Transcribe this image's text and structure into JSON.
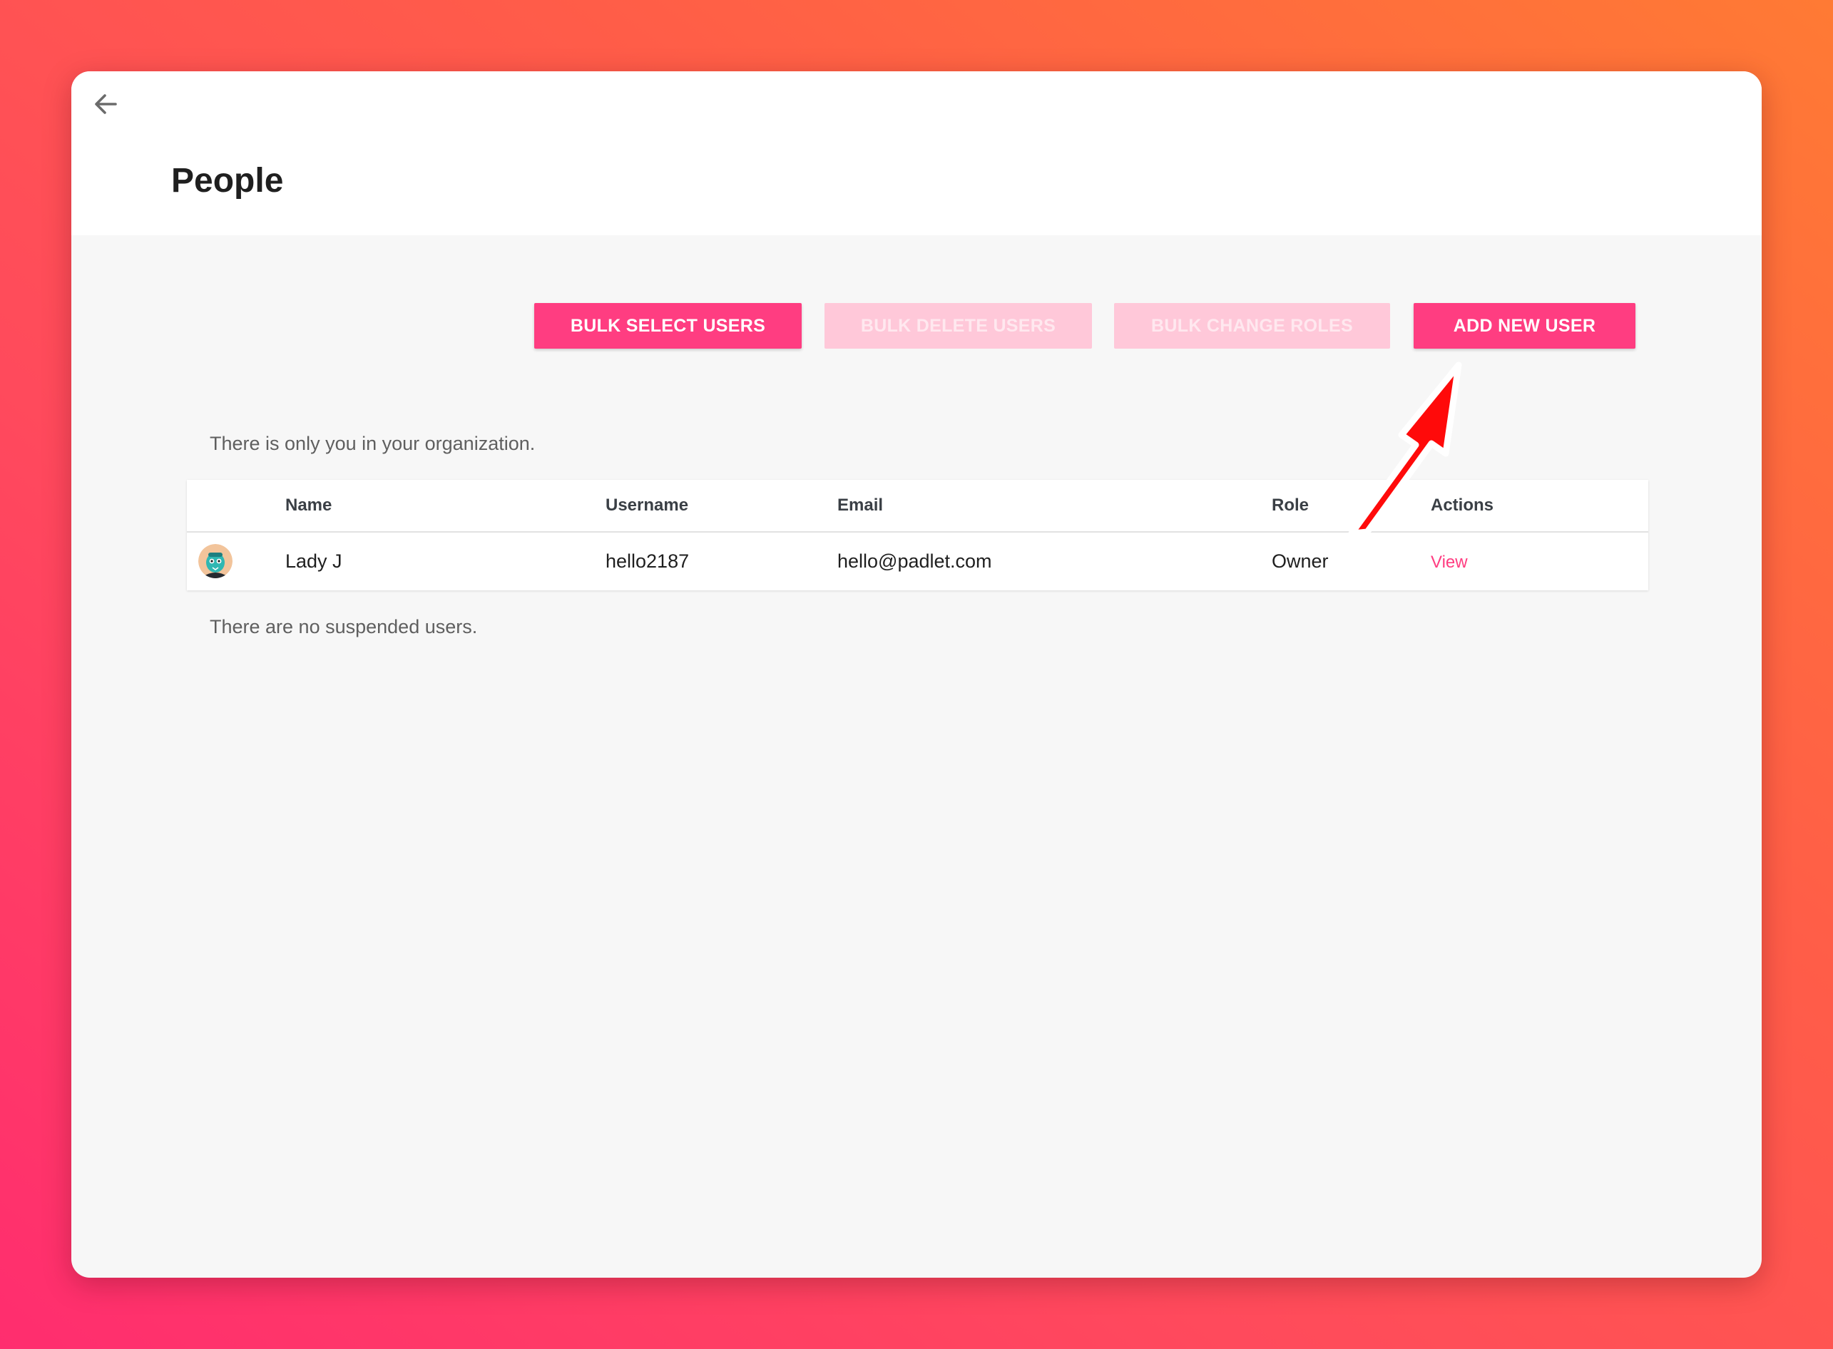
{
  "header": {
    "title": "People"
  },
  "toolbar": {
    "bulk_select_label": "BULK SELECT USERS",
    "bulk_delete_label": "BULK DELETE USERS",
    "bulk_change_roles_label": "BULK CHANGE ROLES",
    "add_new_user_label": "ADD NEW USER"
  },
  "messages": {
    "only_you": "There is only you in your organization.",
    "no_suspended": "There are no suspended users."
  },
  "table": {
    "columns": [
      "Name",
      "Username",
      "Email",
      "Role",
      "Actions"
    ],
    "rows": [
      {
        "name": "Lady J",
        "username": "hello2187",
        "email": "hello@padlet.com",
        "role": "Owner",
        "action": "View"
      }
    ]
  },
  "colors": {
    "accent": "#ff3d81",
    "accent_disabled": "#ffc8d9",
    "annotation_arrow": "#ff0000"
  },
  "icons": {
    "back": "arrow-left-icon",
    "avatar": "user-avatar",
    "annotation": "red-arrow-annotation"
  }
}
